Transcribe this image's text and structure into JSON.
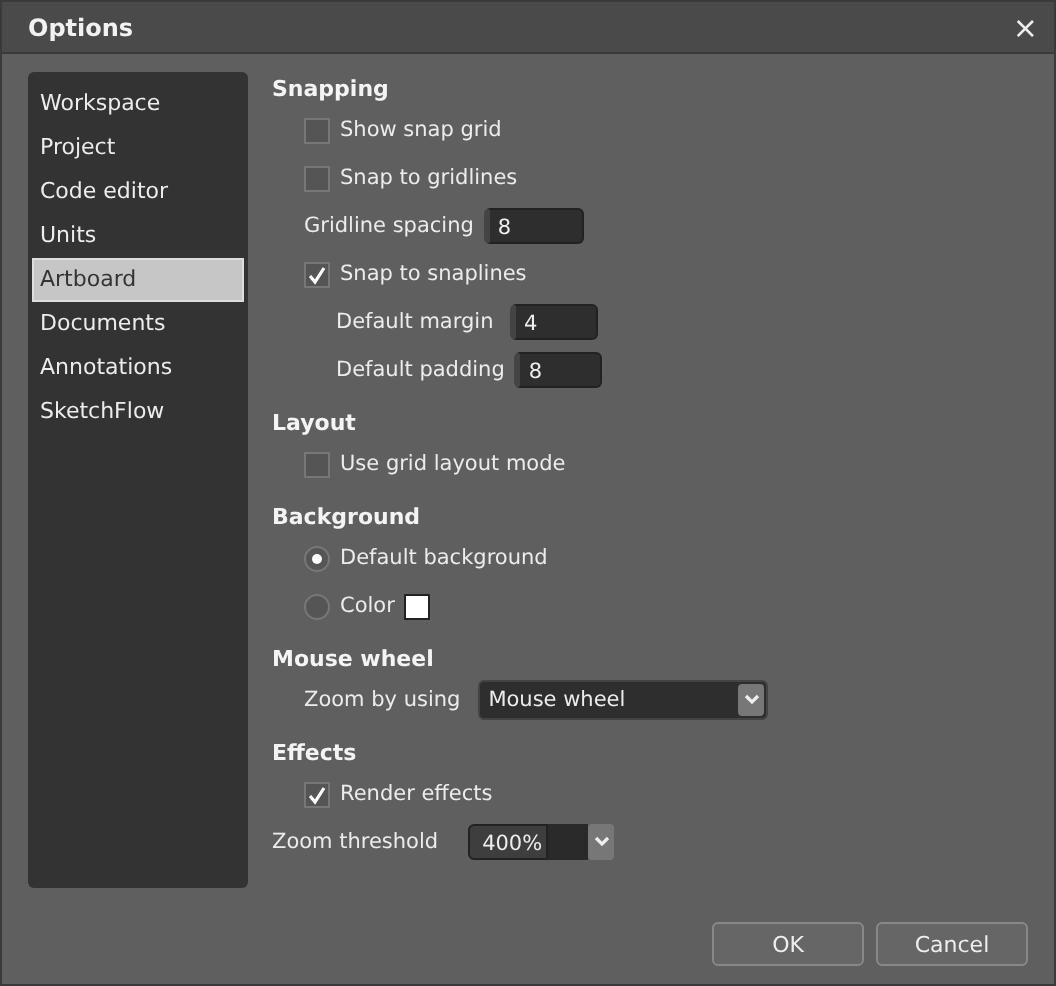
{
  "window": {
    "title": "Options",
    "close": "×"
  },
  "sidebar": {
    "items": [
      {
        "label": "Workspace",
        "selected": false
      },
      {
        "label": "Project",
        "selected": false
      },
      {
        "label": "Code editor",
        "selected": false
      },
      {
        "label": "Units",
        "selected": false
      },
      {
        "label": "Artboard",
        "selected": true
      },
      {
        "label": "Documents",
        "selected": false
      },
      {
        "label": "Annotations",
        "selected": false
      },
      {
        "label": "SketchFlow",
        "selected": false
      }
    ]
  },
  "sections": [
    {
      "heading": "Snapping",
      "items": [
        {
          "kind": "checkbox",
          "label": "Show snap grid",
          "checked": false
        },
        {
          "kind": "checkbox",
          "label": "Snap to gridlines",
          "checked": false
        },
        {
          "kind": "number",
          "label": "Gridline spacing",
          "value": "8"
        },
        {
          "kind": "checkbox",
          "label": "Snap to snaplines",
          "checked": true,
          "children": [
            {
              "kind": "number",
              "label": "Default margin",
              "value": "4"
            },
            {
              "kind": "number",
              "label": "Default padding",
              "value": "8"
            }
          ]
        }
      ]
    },
    {
      "heading": "Layout",
      "items": [
        {
          "kind": "checkbox",
          "label": "Use grid layout mode",
          "checked": false
        }
      ]
    },
    {
      "heading": "Background",
      "items": [
        {
          "kind": "radio",
          "label": "Default background",
          "selected": true
        },
        {
          "kind": "radio",
          "label": "Color",
          "selected": false,
          "color": "#ffffff"
        }
      ]
    },
    {
      "heading": "Mouse wheel",
      "items": [
        {
          "kind": "dropdown",
          "label": "Zoom by using",
          "value": "Mouse wheel"
        }
      ]
    },
    {
      "heading": "Effects",
      "items": [
        {
          "kind": "checkbox",
          "label": "Render effects",
          "checked": true
        },
        {
          "kind": "combo",
          "label": "Zoom threshold",
          "value": "400%"
        }
      ]
    }
  ],
  "buttons": [
    "OK",
    "Cancel"
  ]
}
